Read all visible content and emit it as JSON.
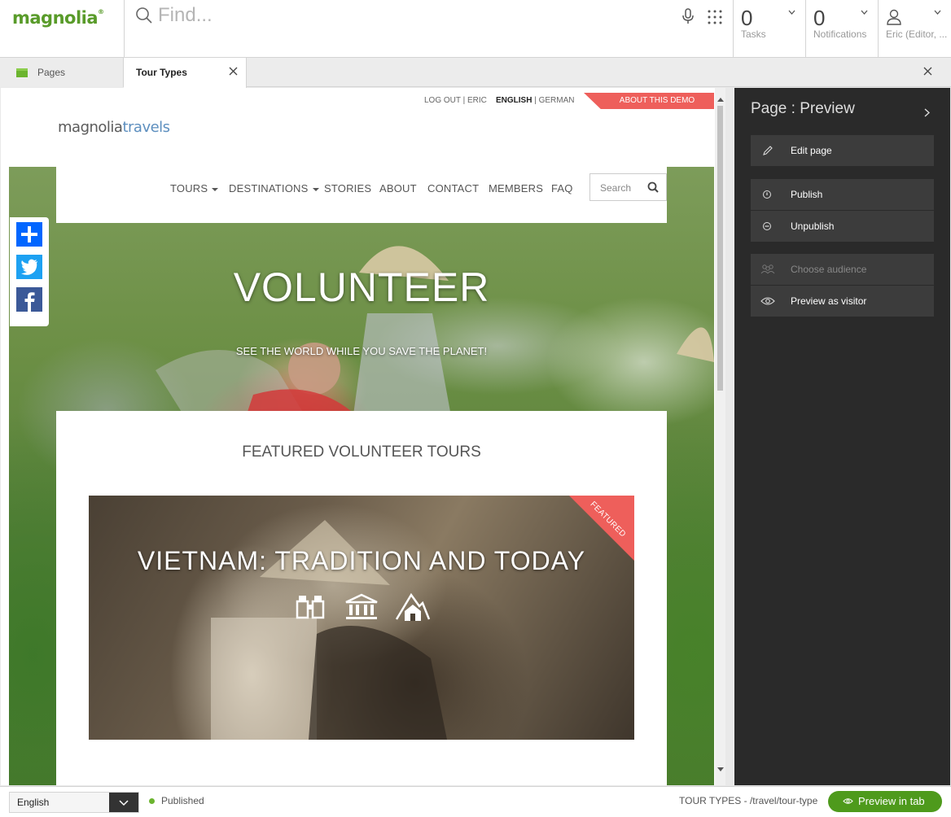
{
  "app": {
    "logo": "magnolia",
    "search_placeholder": "Find...",
    "tasks": {
      "count": "0",
      "label": "Tasks"
    },
    "notifications": {
      "count": "0",
      "label": "Notifications"
    },
    "user": {
      "label": "Eric (Editor, ..."
    }
  },
  "tabs": {
    "pages_label": "Pages",
    "active_label": "Tour Types"
  },
  "site": {
    "logout": "LOG OUT | ERIC",
    "lang_active": "ENGLISH",
    "lang_sep": " | ",
    "lang_other": "GERMAN",
    "about_demo": "ABOUT THIS DEMO",
    "logo_part1": "magnolia",
    "logo_part2": "travels",
    "nav": [
      {
        "label": "TOURS"
      },
      {
        "label": "DESTINATIONS"
      },
      {
        "label": "STORIES"
      },
      {
        "label": "ABOUT"
      },
      {
        "label": "CONTACT"
      },
      {
        "label": "MEMBERS"
      },
      {
        "label": "FAQ"
      }
    ],
    "search_label": "Search",
    "hero_title": "VOLUNTEER",
    "hero_subtitle": "SEE THE WORLD WHILE YOU SAVE THE PLANET!",
    "featured_heading": "FEATURED VOLUNTEER TOURS",
    "tour_title": "VIETNAM: TRADITION AND TODAY",
    "featured_badge": "FEATURED"
  },
  "panel": {
    "title": "Page : Preview",
    "actions": {
      "edit": "Edit page",
      "publish": "Publish",
      "unpublish": "Unpublish",
      "audience": "Choose audience",
      "preview_visitor": "Preview as visitor"
    }
  },
  "footer": {
    "language": "English",
    "status": "Published",
    "path": "TOUR TYPES - /travel/tour-type",
    "preview_tab": "Preview in tab"
  },
  "colors": {
    "brand_green": "#599b2a",
    "accent_red": "#ee5f5b",
    "panel_bg": "#2a2a2a",
    "button_green": "#4e9a1c"
  }
}
